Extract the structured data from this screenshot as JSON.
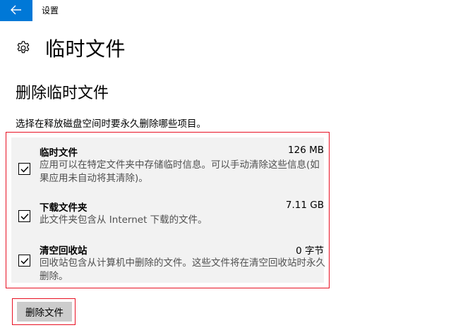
{
  "window": {
    "title": "设置"
  },
  "header": {
    "title": "临时文件",
    "icon": "gear-icon"
  },
  "section": {
    "title": "删除临时文件",
    "description": "选择在释放磁盘空间时要永久删除哪些项目。"
  },
  "items": [
    {
      "name": "临时文件",
      "size": "126 MB",
      "description": "应用可以在特定文件夹中存储临时信息。可以手动清除这些信息(如果应用未自动将其清除)。",
      "checked": true
    },
    {
      "name": "下载文件夹",
      "size": "7.11 GB",
      "description": "此文件夹包含从 Internet 下载的文件。",
      "checked": true
    },
    {
      "name": "清空回收站",
      "size": "0 字节",
      "description": "回收站包含从计算机中删除的文件。这些文件将在清空回收站时永久删除。",
      "checked": true
    }
  ],
  "actions": {
    "delete_label": "删除文件"
  },
  "colors": {
    "accent": "#0078d7",
    "highlight_border": "#e81123",
    "panel_background": "#f2f2f2",
    "button_background": "#cccccc"
  }
}
